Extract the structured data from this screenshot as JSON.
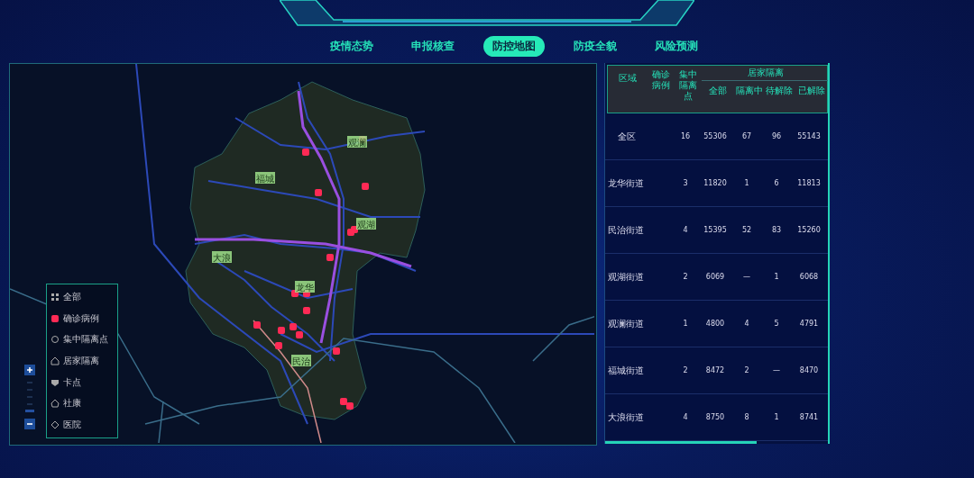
{
  "nav": {
    "tabs": [
      {
        "label": "疫情态势",
        "selected": false
      },
      {
        "label": "申报核查",
        "selected": false
      },
      {
        "label": "防控地图",
        "selected": true
      },
      {
        "label": "防疫全貌",
        "selected": false
      },
      {
        "label": "风险预测",
        "selected": false
      }
    ]
  },
  "map": {
    "districts": [
      {
        "label": "观澜"
      },
      {
        "label": "福城"
      },
      {
        "label": "观湖"
      },
      {
        "label": "大浪"
      },
      {
        "label": "龙华"
      },
      {
        "label": "民治"
      }
    ],
    "legend": [
      {
        "kind": "all",
        "label": "全部"
      },
      {
        "kind": "case",
        "label": "确诊病例"
      },
      {
        "kind": "quarantine",
        "label": "集中隔离点"
      },
      {
        "kind": "home",
        "label": "居家隔离"
      },
      {
        "kind": "checkpoint",
        "label": "卡点"
      },
      {
        "kind": "community",
        "label": "社康"
      },
      {
        "kind": "hospital",
        "label": "医院"
      }
    ]
  },
  "table": {
    "columns": {
      "region": "区域",
      "confirmed": "确诊病例",
      "centralized": "集中隔离点",
      "home_group": "居家隔离",
      "home_sub": [
        "全部",
        "隔离中",
        "待解除",
        "已解除"
      ]
    },
    "rows": [
      {
        "cells": [
          "全区",
          "",
          "16",
          "55306",
          "67",
          "96",
          "55143"
        ]
      },
      {
        "cells": [
          "龙华街道",
          "",
          "3",
          "11820",
          "1",
          "6",
          "11813"
        ]
      },
      {
        "cells": [
          "民治街道",
          "",
          "4",
          "15395",
          "52",
          "83",
          "15260"
        ]
      },
      {
        "cells": [
          "观湖街道",
          "",
          "2",
          "6069",
          "—",
          "1",
          "6068"
        ]
      },
      {
        "cells": [
          "观澜街道",
          "",
          "1",
          "4800",
          "4",
          "5",
          "4791"
        ]
      },
      {
        "cells": [
          "福城街道",
          "",
          "2",
          "8472",
          "2",
          "—",
          "8470"
        ]
      },
      {
        "cells": [
          "大浪街道",
          "",
          "4",
          "8750",
          "8",
          "1",
          "8741"
        ]
      }
    ]
  }
}
